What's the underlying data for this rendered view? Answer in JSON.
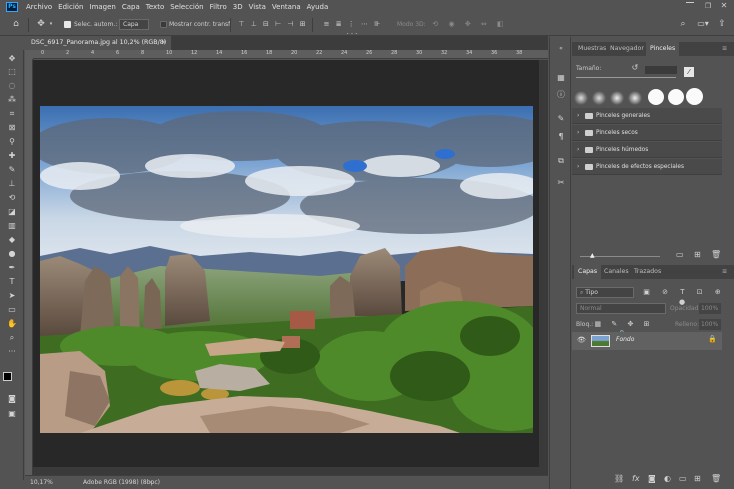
{
  "app": {
    "logo": "Ps"
  },
  "menu": [
    "Archivo",
    "Edición",
    "Imagen",
    "Capa",
    "Texto",
    "Selección",
    "Filtro",
    "3D",
    "Vista",
    "Ventana",
    "Ayuda"
  ],
  "options": {
    "auto_select_label": "Selec. autom.:",
    "auto_select_value": "Capa",
    "show_transform_label": "Mostrar contr. transf.",
    "mode3d_label": "Modo 3D:"
  },
  "document": {
    "tab_title": "DSC_6917_Panorama.jpg al 10,2% (RGB/8)",
    "zoom": "10,17%",
    "color_profile": "Adobe RGB (1998) (8bpc)"
  },
  "ruler": {
    "top_labels": [
      "0",
      "2",
      "4",
      "6",
      "8",
      "10",
      "12",
      "14",
      "16",
      "18",
      "20",
      "22",
      "24",
      "26",
      "28",
      "30",
      "32",
      "34",
      "36",
      "38"
    ]
  },
  "panels_top": {
    "tabs": [
      "Muestras",
      "Navegador",
      "Pinceles"
    ],
    "active_tab": "Pinceles",
    "size_label": "Tamaño:",
    "brush_folders": [
      "Pinceles generales",
      "Pinceles secos",
      "Pinceles húmedos",
      "Pinceles de efectos especiales"
    ]
  },
  "layers": {
    "tabs": [
      "Capas",
      "Canales",
      "Trazados"
    ],
    "active_tab": "Capas",
    "filter_label": "Tipo",
    "blend_mode": "Normal",
    "opacity_label": "Opacidad:",
    "opacity_value": "100%",
    "lock_label": "Bloq.:",
    "fill_label": "Relleno:",
    "fill_value": "100%",
    "items": [
      {
        "name": "Fondo",
        "visible": true,
        "locked": true
      }
    ]
  },
  "colors": {
    "accent": "#31a8ff",
    "panel_bg": "#535353",
    "canvas_bg": "#282828"
  }
}
